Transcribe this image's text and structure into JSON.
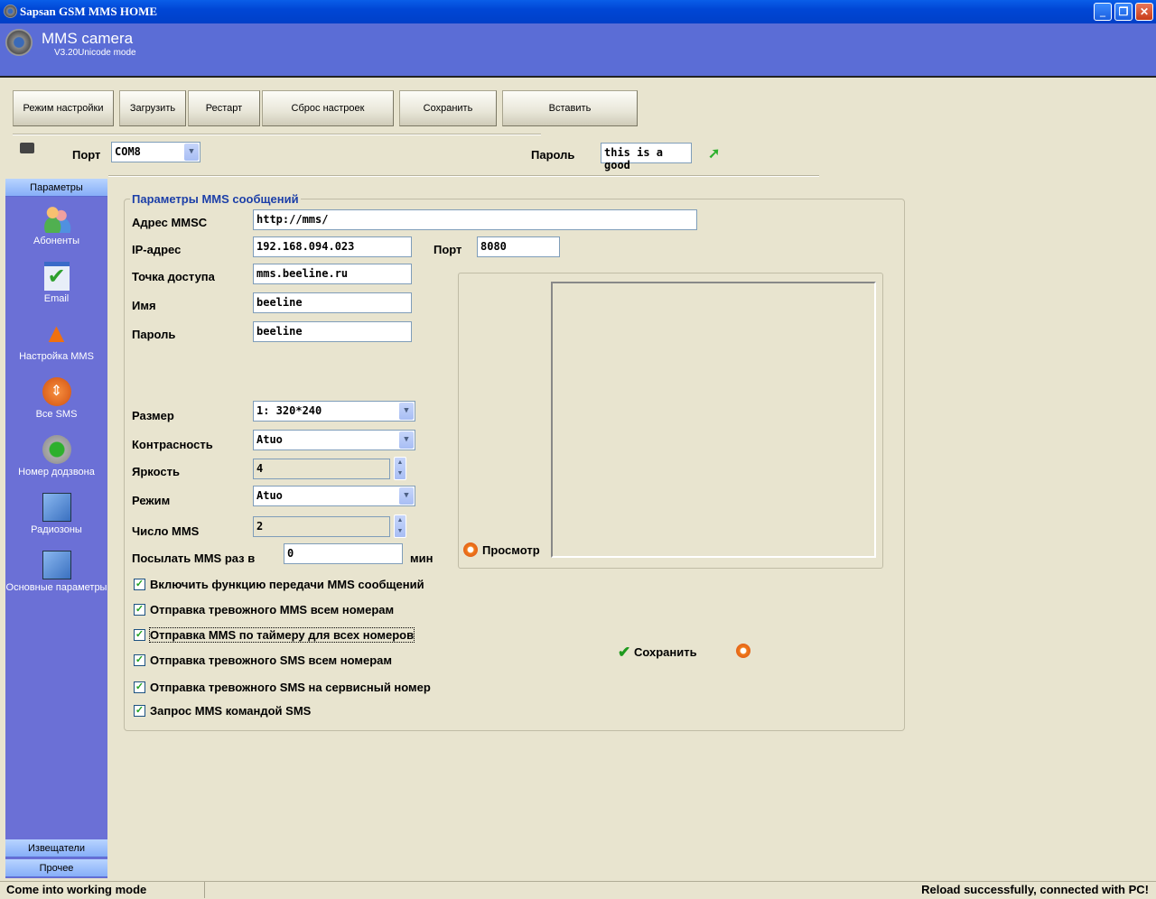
{
  "window": {
    "title": "Sapsan GSM MMS HOME",
    "controls": [
      "minimize",
      "restore",
      "close"
    ]
  },
  "header": {
    "app_name": "MMS camera",
    "version": "V3.20Unicode mode"
  },
  "toolbar": {
    "buttons": [
      "Режим настройки",
      "Загрузить",
      "Рестарт",
      "Сброс настроек",
      "Сохранить",
      "Вставить"
    ]
  },
  "connection": {
    "port_label": "Порт",
    "port_value": "COM8",
    "password_label": "Пароль",
    "password_value": "this is a good"
  },
  "sidebar": {
    "header": "Параметры",
    "items": [
      {
        "label": "Абоненты",
        "icon": "users-icon"
      },
      {
        "label": "Email",
        "icon": "email-check-icon"
      },
      {
        "label": "Настройка MMS",
        "icon": "warning-icon"
      },
      {
        "label": "Все SMS",
        "icon": "arrows-icon"
      },
      {
        "label": "Номер додзвона",
        "icon": "gear-refresh-icon"
      },
      {
        "label": "Радиозоны",
        "icon": "monitor-gear-icon"
      },
      {
        "label": "Основные параметры",
        "icon": "monitor-gear-icon"
      }
    ],
    "footer": [
      "Извещатели",
      "Прочее"
    ]
  },
  "form": {
    "group_title": "Параметры MMS сообщений",
    "mmsc_label": "Адрес MMSC",
    "mmsc_value": "http://mms/",
    "ip_label": "IP-адрес",
    "ip_value": "192.168.094.023",
    "port_label": "Порт",
    "port_value": "8080",
    "apn_label": "Точка доступа",
    "apn_value": "mms.beeline.ru",
    "name_label": "Имя",
    "name_value": "beeline",
    "password_label": "Пароль",
    "password_value": "beeline",
    "size_label": "Размер",
    "size_value": "1: 320*240",
    "contrast_label": "Контрасность",
    "contrast_value": "Atuo",
    "brightness_label": "Яркость",
    "brightness_value": "4",
    "mode_label": "Режим",
    "mode_value": "Atuo",
    "count_label": "Число MMS",
    "count_value": "2",
    "interval_label": "Посылать MMS раз в",
    "interval_value": "0",
    "interval_unit": "мин",
    "preview_label": "Просмотр",
    "save_label": "Сохранить",
    "checkboxes": [
      {
        "label": "Включить функцию передачи MMS сообщений",
        "checked": true
      },
      {
        "label": "Отправка тревожного MMS всем номерам",
        "checked": true
      },
      {
        "label": "Отправка MMS по таймеру для всех номеров",
        "checked": true
      },
      {
        "label": "Отправка тревожного SMS всем номерам",
        "checked": true
      },
      {
        "label": "Отправка тревожного SMS на сервисный номер",
        "checked": true
      },
      {
        "label": "Запрос MMS командой SMS",
        "checked": true
      }
    ]
  },
  "status": {
    "left": "Come into working mode",
    "right": "Reload successfully, connected with PC!"
  }
}
